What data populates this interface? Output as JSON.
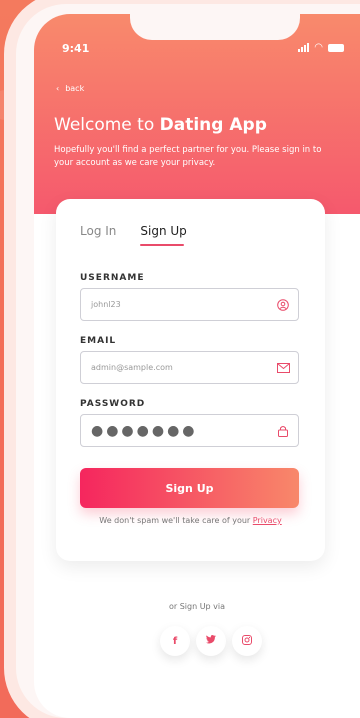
{
  "status": {
    "time": "9:41"
  },
  "nav": {
    "back": "back"
  },
  "header": {
    "title_prefix": "Welcome to ",
    "title_brand": "Dating App",
    "subtitle": "Hopefully you'll find a perfect partner for you. Please sign in to your account as we care your privacy."
  },
  "tabs": {
    "login": "Log In",
    "signup": "Sign Up"
  },
  "form": {
    "username_label": "USERNAME",
    "username_value": "johnl23",
    "email_label": "EMAIL",
    "email_placeholder": "admin@sample.com",
    "password_label": "PASSWORD",
    "password_value": "●●●●●●●"
  },
  "cta": {
    "signup": "Sign Up"
  },
  "spam": {
    "text": "We don't spam we'll take care of your ",
    "link": "Privacy"
  },
  "social": {
    "label": "or Sign Up via",
    "facebook": "f",
    "twitter": "🐦",
    "instagram": "◎"
  },
  "colors": {
    "accent": "#e94b6a",
    "gradient_start": "#f5265e",
    "gradient_end": "#f8886a"
  }
}
